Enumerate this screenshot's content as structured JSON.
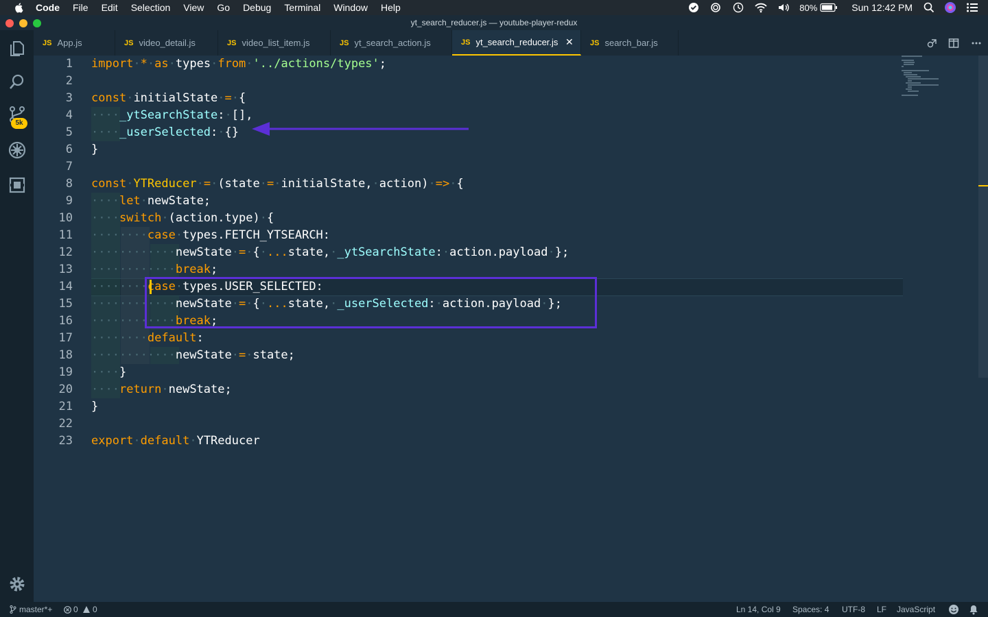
{
  "menubar": {
    "items": [
      "Code",
      "File",
      "Edit",
      "Selection",
      "View",
      "Go",
      "Debug",
      "Terminal",
      "Window",
      "Help"
    ],
    "battery": "80%",
    "clock": "Sun 12:42 PM"
  },
  "window": {
    "title": "yt_search_reducer.js — youtube-player-redux"
  },
  "tabs": [
    {
      "icon_label": "JS",
      "label": "App.js"
    },
    {
      "icon_label": "JS",
      "label": "video_detail.js"
    },
    {
      "icon_label": "JS",
      "label": "video_list_item.js"
    },
    {
      "icon_label": "JS",
      "label": "yt_search_action.js"
    },
    {
      "icon_label": "JS",
      "label": "yt_search_reducer.js",
      "active": true,
      "close": "✕"
    },
    {
      "icon_label": "JS",
      "label": "search_bar.js"
    }
  ],
  "activity": {
    "scm_badge": "5k"
  },
  "editor": {
    "line_numbers": [
      "1",
      "2",
      "3",
      "4",
      "5",
      "6",
      "7",
      "8",
      "9",
      "10",
      "11",
      "12",
      "13",
      "14",
      "15",
      "16",
      "17",
      "18",
      "19",
      "20",
      "21",
      "22",
      "23"
    ],
    "lines": [
      "import * as types from '../actions/types';",
      "",
      "const initialState = {",
      "    _ytSearchState: [],",
      "    _userSelected: {}",
      "}",
      "",
      "const YTReducer = (state = initialState, action) => {",
      "    let newState;",
      "    switch (action.type) {",
      "        case types.FETCH_YTSEARCH:",
      "            newState = { ...state, _ytSearchState: action.payload };",
      "            break;",
      "        case types.USER_SELECTED:",
      "            newState = { ...state, _userSelected: action.payload };",
      "            break;",
      "        default:",
      "            newState = state;",
      "    }",
      "    return newState;",
      "}",
      "",
      "export default YTReducer"
    ]
  },
  "statusbar": {
    "branch": "master*+",
    "errors": "0",
    "warnings": "0",
    "position": "Ln 14, Col 9",
    "spaces": "Spaces: 4",
    "encoding": "UTF-8",
    "eol": "LF",
    "language": "JavaScript"
  },
  "colors": {
    "editor_bg": "#1f3445",
    "keyword": "#ffc600",
    "string": "#a5ff90",
    "property": "#9effff",
    "annotation": "#5b2fd6"
  }
}
